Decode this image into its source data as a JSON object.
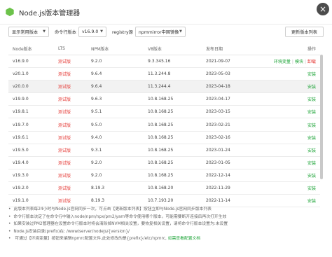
{
  "window": {
    "title": "Node.js版本管理器"
  },
  "toolbar": {
    "filter_select": "显示常用版本",
    "cli_label": "命令行版本",
    "cli_select": "v16.9.0",
    "registry_label": "registry源",
    "registry_select": "npmmirror中国镜像",
    "refresh_button": "更新版本列表"
  },
  "table": {
    "headers": [
      "Node版本",
      "LTS",
      "NPM版本",
      "V8版本",
      "发布日期",
      "操作"
    ],
    "rows": [
      {
        "version": "v16.9.0",
        "lts": "测试版",
        "npm": "9.2.0",
        "v8": "9.3.345.16",
        "date": "2021-09-07",
        "action_type": "installed",
        "a1": "环境变量",
        "a2": "模块",
        "a3": "卸载"
      },
      {
        "version": "v20.1.0",
        "lts": "测试版",
        "npm": "9.6.4",
        "v8": "11.3.244.8",
        "date": "2023-05-03",
        "action": "安装"
      },
      {
        "version": "v20.0.0",
        "lts": "测试版",
        "npm": "9.6.4",
        "v8": "11.3.244.4",
        "date": "2023-04-18",
        "action": "安装",
        "highlight": true
      },
      {
        "version": "v19.9.0",
        "lts": "测试版",
        "npm": "9.6.3",
        "v8": "10.8.168.25",
        "date": "2023-04-17",
        "action": "安装"
      },
      {
        "version": "v19.8.1",
        "lts": "测试版",
        "npm": "9.5.1",
        "v8": "10.8.168.25",
        "date": "2023-03-15",
        "action": "安装"
      },
      {
        "version": "v19.7.0",
        "lts": "测试版",
        "npm": "9.5.0",
        "v8": "10.8.168.25",
        "date": "2023-02-21",
        "action": "安装"
      },
      {
        "version": "v19.6.1",
        "lts": "测试版",
        "npm": "9.4.0",
        "v8": "10.8.168.25",
        "date": "2023-02-16",
        "action": "安装"
      },
      {
        "version": "v19.5.0",
        "lts": "测试版",
        "npm": "9.3.1",
        "v8": "10.8.168.25",
        "date": "2023-01-24",
        "action": "安装"
      },
      {
        "version": "v19.4.0",
        "lts": "测试版",
        "npm": "9.2.0",
        "v8": "10.8.168.25",
        "date": "2023-01-05",
        "action": "安装"
      },
      {
        "version": "v19.3.0",
        "lts": "测试版",
        "npm": "9.2.0",
        "v8": "10.8.168.25",
        "date": "2022-12-14",
        "action": "安装"
      },
      {
        "version": "v19.2.0",
        "lts": "测试版",
        "npm": "8.19.3",
        "v8": "10.8.168.20",
        "date": "2022-11-29",
        "action": "安装"
      },
      {
        "version": "v19.1.0",
        "lts": "测试版",
        "npm": "8.19.3",
        "v8": "10.7.193.20",
        "date": "2022-11-14",
        "action": "安装"
      }
    ]
  },
  "notes": [
    "此版本列表每24小时与Node.js官网同步一次，可点击【更新版本列表】按钮立即与Node.js官网同步版本列表",
    "命令行版本决定了在命令行中输入node/npm/npx/pm2/yarn等命令使用哪个版本，可能需要断开连接后再次打开生效",
    "如果安装过PM2管理器在设置命令行版本时将会清除掉NVM相关设置，要恢复相关设置，请将命令行版本设置为:未设置",
    "Node.js安装目录(prefix)在: /www/server/nodejs/{version}/"
  ],
  "last_note": {
    "prefix": "可通过【环境变量】按钮来编辑npmrc配置文件,此处修改的是{prefix}/etc/npmrc,",
    "link": "如需查看配置文档"
  }
}
